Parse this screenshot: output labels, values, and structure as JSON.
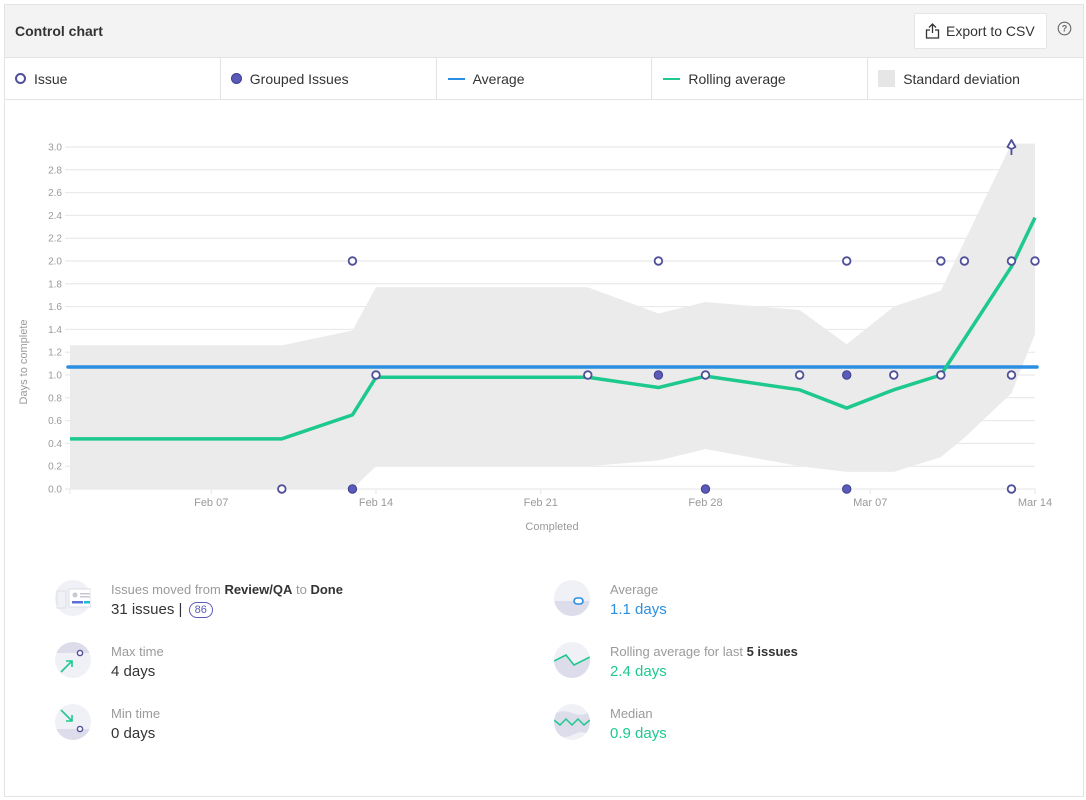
{
  "header": {
    "title": "Control chart",
    "export_label": "Export to CSV",
    "help_icon": "question-circle-icon",
    "export_icon": "upload-share-icon"
  },
  "legend": [
    {
      "label": "Issue",
      "icon": "hollow-circle"
    },
    {
      "label": "Grouped Issues",
      "icon": "filled-circle"
    },
    {
      "label": "Average",
      "icon": "blue-line"
    },
    {
      "label": "Rolling average",
      "icon": "green-line"
    },
    {
      "label": "Standard deviation",
      "icon": "gray-square"
    }
  ],
  "colors": {
    "issue": "#4f4f9a",
    "grouped": "#5a5ab8",
    "average": "#2a8fe0",
    "rolling": "#1ec98d",
    "stddev": "#ebebeb",
    "grid": "#e6e6e6",
    "tick": "#9a9a9a"
  },
  "chart_data": {
    "type": "scatter",
    "title": "Control chart",
    "xlabel": "Completed",
    "ylabel": "Days to complete",
    "x_unit": "days since Feb 01",
    "xlim": [
      0,
      41
    ],
    "ylim": [
      0,
      3.0
    ],
    "yticks": [
      0.0,
      0.2,
      0.4,
      0.6,
      0.8,
      1.0,
      1.2,
      1.4,
      1.6,
      1.8,
      2.0,
      2.2,
      2.4,
      2.6,
      2.8,
      3.0
    ],
    "ytick_labels": [
      "0.0",
      "0.2",
      "0.4",
      "0.6",
      "0.8",
      "1.0",
      "1.2",
      "1.4",
      "1.6",
      "1.8",
      "2.0",
      "2.2",
      "2.4",
      "2.6",
      "2.8",
      "3.0"
    ],
    "xticks": [
      6,
      13,
      20,
      27,
      34,
      41
    ],
    "xtick_labels": [
      "Feb 07",
      "Feb 14",
      "Feb 21",
      "Feb 28",
      "Mar 07",
      "Mar 14"
    ],
    "grid": true,
    "issues": [
      {
        "x": 9.0,
        "y": 0.0
      },
      {
        "x": 12.0,
        "y": 2.0
      },
      {
        "x": 13.0,
        "y": 1.0
      },
      {
        "x": 22.0,
        "y": 1.0
      },
      {
        "x": 25.0,
        "y": 2.0
      },
      {
        "x": 27.0,
        "y": 1.0
      },
      {
        "x": 31.0,
        "y": 1.0
      },
      {
        "x": 33.0,
        "y": 2.0
      },
      {
        "x": 35.0,
        "y": 1.0
      },
      {
        "x": 37.0,
        "y": 2.0
      },
      {
        "x": 37.0,
        "y": 1.0
      },
      {
        "x": 38.0,
        "y": 2.0
      },
      {
        "x": 40.0,
        "y": 2.0
      },
      {
        "x": 40.0,
        "y": 1.0
      },
      {
        "x": 40.0,
        "y": 0.0
      },
      {
        "x": 41.0,
        "y": 2.0
      }
    ],
    "grouped_issues": [
      {
        "x": 12.0,
        "y": 0.0
      },
      {
        "x": 25.0,
        "y": 1.0
      },
      {
        "x": 27.0,
        "y": 0.0
      },
      {
        "x": 33.0,
        "y": 1.0
      },
      {
        "x": 33.0,
        "y": 0.0
      }
    ],
    "offscale_marker": {
      "x": 40.0,
      "y": 3.0,
      "note": "value above axis (max 4 days)"
    },
    "average": 1.07,
    "rolling_average": [
      {
        "x": 0.0,
        "y": 0.44
      },
      {
        "x": 9.0,
        "y": 0.44
      },
      {
        "x": 12.0,
        "y": 0.65
      },
      {
        "x": 13.0,
        "y": 0.98
      },
      {
        "x": 22.0,
        "y": 0.98
      },
      {
        "x": 25.0,
        "y": 0.89
      },
      {
        "x": 27.0,
        "y": 0.99
      },
      {
        "x": 31.0,
        "y": 0.87
      },
      {
        "x": 33.0,
        "y": 0.71
      },
      {
        "x": 35.0,
        "y": 0.87
      },
      {
        "x": 37.0,
        "y": 1.0
      },
      {
        "x": 40.0,
        "y": 1.95
      },
      {
        "x": 41.0,
        "y": 2.38
      }
    ],
    "stddev_upper": [
      {
        "x": 0.0,
        "y": 1.26
      },
      {
        "x": 9.0,
        "y": 1.26
      },
      {
        "x": 12.0,
        "y": 1.39
      },
      {
        "x": 13.0,
        "y": 1.77
      },
      {
        "x": 22.0,
        "y": 1.77
      },
      {
        "x": 25.0,
        "y": 1.54
      },
      {
        "x": 27.0,
        "y": 1.64
      },
      {
        "x": 31.0,
        "y": 1.57
      },
      {
        "x": 33.0,
        "y": 1.27
      },
      {
        "x": 35.0,
        "y": 1.6
      },
      {
        "x": 37.0,
        "y": 1.74
      },
      {
        "x": 40.0,
        "y": 3.03
      },
      {
        "x": 41.0,
        "y": 3.03
      }
    ],
    "stddev_lower": [
      {
        "x": 0.0,
        "y": 0.0
      },
      {
        "x": 12.0,
        "y": 0.0
      },
      {
        "x": 13.0,
        "y": 0.2
      },
      {
        "x": 22.0,
        "y": 0.2
      },
      {
        "x": 25.0,
        "y": 0.25
      },
      {
        "x": 27.0,
        "y": 0.35
      },
      {
        "x": 31.0,
        "y": 0.2
      },
      {
        "x": 33.0,
        "y": 0.15
      },
      {
        "x": 35.0,
        "y": 0.15
      },
      {
        "x": 37.0,
        "y": 0.28
      },
      {
        "x": 38.0,
        "y": 0.45
      },
      {
        "x": 40.0,
        "y": 0.84
      },
      {
        "x": 41.0,
        "y": 1.36
      }
    ]
  },
  "stats": {
    "moved": {
      "prefix": "Issues moved from ",
      "from": "Review/QA",
      "mid": " to ",
      "to": "Done",
      "value": "31 issues | ",
      "badge": "86"
    },
    "max": {
      "label": "Max time",
      "value": "4 days"
    },
    "min": {
      "label": "Min time",
      "value": "0 days"
    },
    "average": {
      "label": "Average",
      "value": "1.1 days"
    },
    "rolling": {
      "prefix": "Rolling average for last ",
      "bold": "5 issues",
      "value": "2.4 days"
    },
    "median": {
      "label": "Median",
      "value": "0.9 days"
    }
  }
}
